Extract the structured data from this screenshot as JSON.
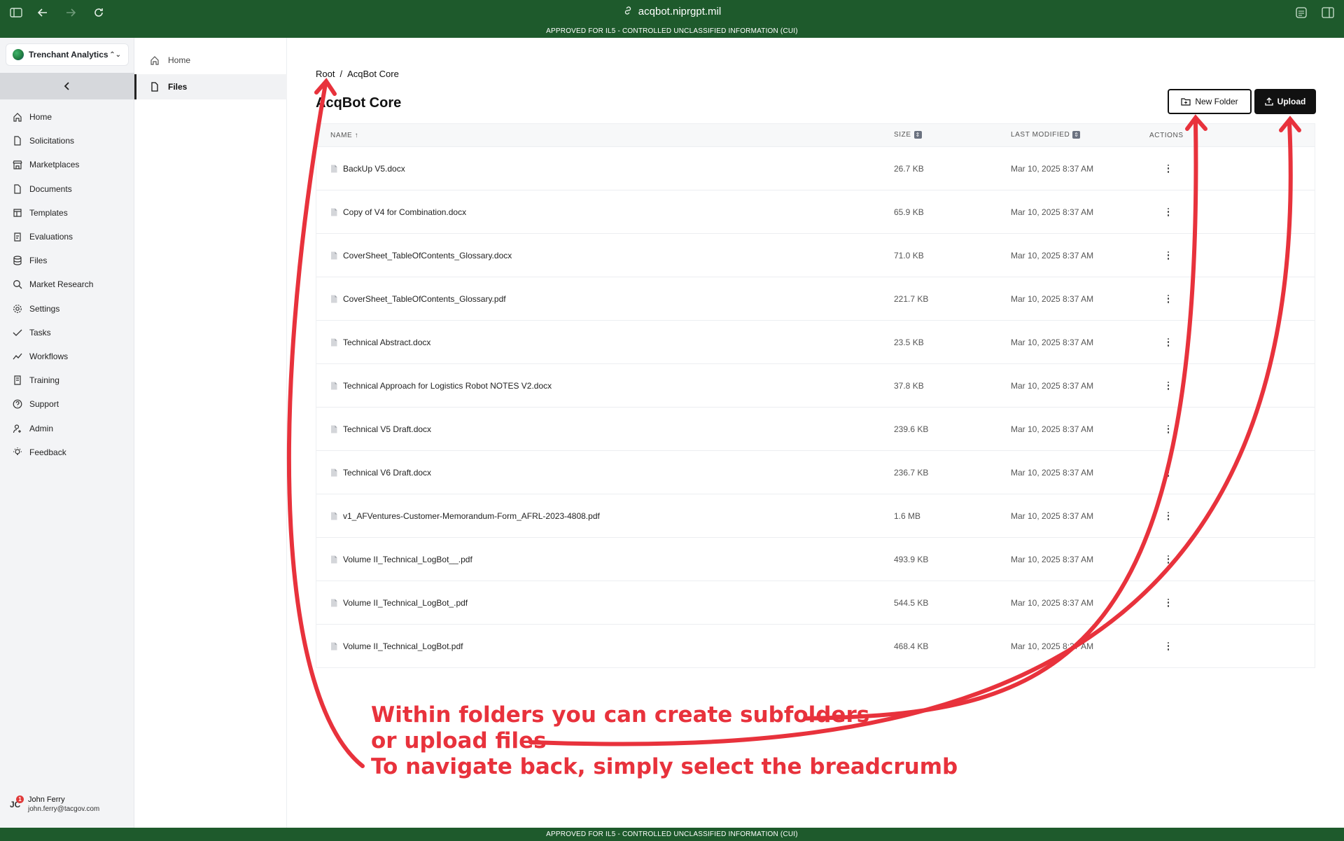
{
  "browser": {
    "url": "acqbot.niprgpt.mil",
    "banner": "APPROVED FOR IL5 - CONTROLLED UNCLASSIFIED INFORMATION (CUI)"
  },
  "sidebar": {
    "org": "Trenchant Analytics",
    "items": [
      {
        "label": "Home",
        "icon": "home-icon"
      },
      {
        "label": "Solicitations",
        "icon": "document-icon"
      },
      {
        "label": "Marketplaces",
        "icon": "store-icon"
      },
      {
        "label": "Documents",
        "icon": "document-icon"
      },
      {
        "label": "Templates",
        "icon": "template-icon"
      },
      {
        "label": "Evaluations",
        "icon": "clipboard-icon"
      },
      {
        "label": "Files",
        "icon": "database-icon"
      },
      {
        "label": "Market Research",
        "icon": "search-icon"
      },
      {
        "label": "Settings",
        "icon": "gear-icon"
      },
      {
        "label": "Tasks",
        "icon": "check-icon"
      },
      {
        "label": "Workflows",
        "icon": "chart-line-icon"
      },
      {
        "label": "Training",
        "icon": "book-icon"
      },
      {
        "label": "Support",
        "icon": "help-icon"
      },
      {
        "label": "Admin",
        "icon": "users-icon"
      },
      {
        "label": "Feedback",
        "icon": "lightbulb-icon"
      }
    ],
    "user": {
      "initials": "JC",
      "badge": "1",
      "name": "John Ferry",
      "email": "john.ferry@tacgov.com"
    }
  },
  "subnav": {
    "home": "Home",
    "files": "Files"
  },
  "main": {
    "breadcrumb": {
      "root": "Root",
      "separator": "/",
      "current": "AcqBot Core"
    },
    "title": "AcqBot Core",
    "new_folder": "New Folder",
    "upload": "Upload",
    "columns": {
      "name": "NAME ↑",
      "size": "SIZE",
      "modified": "LAST MODIFIED",
      "actions": "ACTIONS"
    },
    "files": [
      {
        "name": "BackUp V5.docx",
        "size": "26.7 KB",
        "modified": "Mar 10, 2025 8:37 AM"
      },
      {
        "name": "Copy of V4 for Combination.docx",
        "size": "65.9 KB",
        "modified": "Mar 10, 2025 8:37 AM"
      },
      {
        "name": "CoverSheet_TableOfContents_Glossary.docx",
        "size": "71.0 KB",
        "modified": "Mar 10, 2025 8:37 AM"
      },
      {
        "name": "CoverSheet_TableOfContents_Glossary.pdf",
        "size": "221.7 KB",
        "modified": "Mar 10, 2025 8:37 AM"
      },
      {
        "name": "Technical Abstract.docx",
        "size": "23.5 KB",
        "modified": "Mar 10, 2025 8:37 AM"
      },
      {
        "name": "Technical Approach for Logistics Robot NOTES V2.docx",
        "size": "37.8 KB",
        "modified": "Mar 10, 2025 8:37 AM"
      },
      {
        "name": "Technical V5 Draft.docx",
        "size": "239.6 KB",
        "modified": "Mar 10, 2025 8:37 AM"
      },
      {
        "name": "Technical V6 Draft.docx",
        "size": "236.7 KB",
        "modified": "Mar 10, 2025 8:37 AM"
      },
      {
        "name": "v1_AFVentures-Customer-Memorandum-Form_AFRL-2023-4808.pdf",
        "size": "1.6 MB",
        "modified": "Mar 10, 2025 8:37 AM"
      },
      {
        "name": "Volume II_Technical_LogBot__.pdf",
        "size": "493.9 KB",
        "modified": "Mar 10, 2025 8:37 AM"
      },
      {
        "name": "Volume II_Technical_LogBot_.pdf",
        "size": "544.5 KB",
        "modified": "Mar 10, 2025 8:37 AM"
      },
      {
        "name": "Volume II_Technical_LogBot.pdf",
        "size": "468.4 KB",
        "modified": "Mar 10, 2025 8:37 AM"
      }
    ]
  },
  "annotation": {
    "line1": "Within folders you can create subfolders",
    "line2": "or upload files",
    "line3": "To navigate back, simply select the breadcrumb",
    "color": "#e8323c"
  }
}
